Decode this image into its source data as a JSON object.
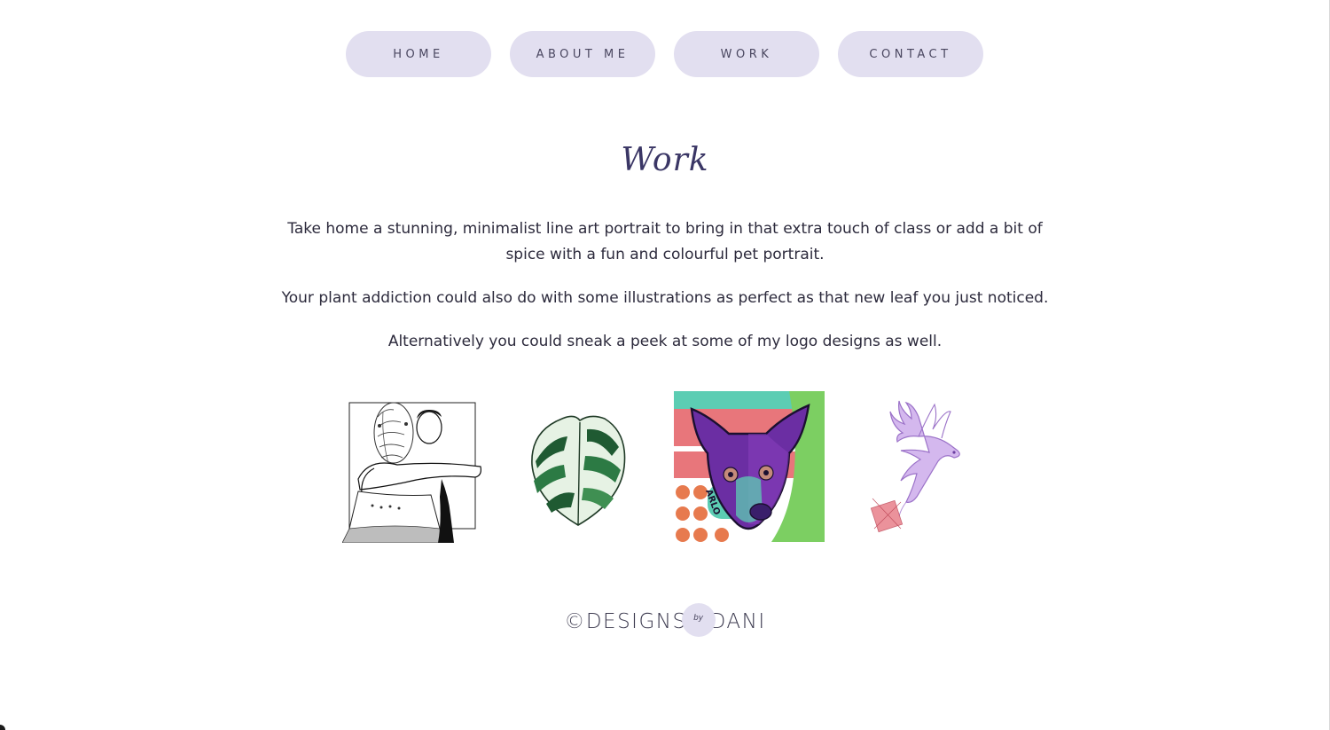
{
  "nav": {
    "items": [
      {
        "label": "HOME"
      },
      {
        "label": "ABOUT ME"
      },
      {
        "label": "WORK"
      },
      {
        "label": "CONTACT"
      }
    ]
  },
  "main": {
    "title": "Work",
    "paragraphs": [
      "Take home a stunning, minimalist line art portrait to bring in that extra touch of class or add a bit of spice with a fun and colourful pet portrait.",
      "Your plant addiction could also do with some illustrations as perfect as that new leaf you just noticed.",
      "Alternatively you could sneak a peek at some of my logo designs as well."
    ]
  },
  "gallery": {
    "items": [
      {
        "name": "line-art-portrait-thumbnail"
      },
      {
        "name": "monstera-leaf-thumbnail"
      },
      {
        "name": "pet-portrait-thumbnail",
        "caption": "ARLO"
      },
      {
        "name": "logo-design-thumbnail"
      }
    ]
  },
  "footer": {
    "copyright": "©",
    "brand_left": "DESIGNS",
    "brand_by": "by",
    "brand_right": "DANI"
  },
  "colors": {
    "nav_bg": "#e2dff0",
    "title": "#3a3665",
    "text": "#2c2a3c",
    "accent_purple": "#6b2ea3",
    "accent_green": "#7ccf62",
    "accent_coral": "#e77a6e",
    "accent_teal": "#5ccdb3"
  }
}
